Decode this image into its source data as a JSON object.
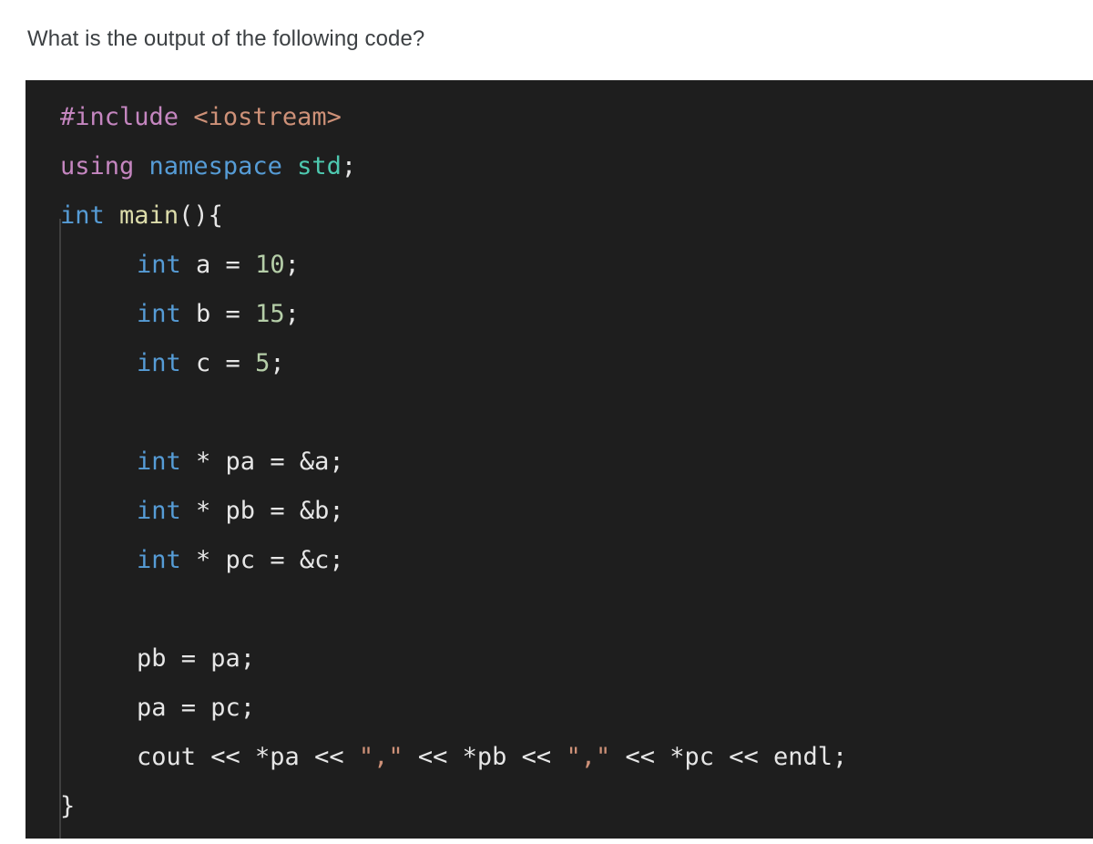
{
  "question": {
    "text": "What is the output of the following code?"
  },
  "colors": {
    "page_background": "#ffffff",
    "code_background": "#1e1e1e",
    "question_text": "#3c4043",
    "indent_guide": "#3f3f3f",
    "token_preprocessor": "#c586c0",
    "token_header": "#ce9178",
    "token_keyword": "#569cd6",
    "token_namespace": "#4ec9b0",
    "token_function": "#dcdcaa",
    "token_number": "#b5cea8",
    "token_string": "#ce9178",
    "token_plain": "#e6e6e6"
  },
  "code": {
    "language": "cpp",
    "plain_text": "#include <iostream>\nusing namespace std;\nint main(){\n    int a = 10;\n    int b = 15;\n    int c = 5;\n\n    int * pa = &a;\n    int * pb = &b;\n    int * pc = &c;\n\n    pb = pa;\n    pa = pc;\n    cout << *pa << \",\" << *pb << \",\" << *pc << endl;\n}",
    "lines": [
      {
        "indent": 0,
        "tokens": [
          {
            "t": "#include",
            "c": "tok-pre"
          },
          {
            "t": " ",
            "c": "tok-plain"
          },
          {
            "t": "<iostream>",
            "c": "tok-header"
          }
        ]
      },
      {
        "indent": 0,
        "tokens": [
          {
            "t": "using",
            "c": "tok-pre"
          },
          {
            "t": " ",
            "c": "tok-plain"
          },
          {
            "t": "namespace",
            "c": "tok-kw"
          },
          {
            "t": " ",
            "c": "tok-plain"
          },
          {
            "t": "std",
            "c": "tok-ns"
          },
          {
            "t": ";",
            "c": "tok-punct"
          }
        ]
      },
      {
        "indent": 0,
        "tokens": [
          {
            "t": "int",
            "c": "tok-kw"
          },
          {
            "t": " ",
            "c": "tok-plain"
          },
          {
            "t": "main",
            "c": "tok-fn"
          },
          {
            "t": "(){",
            "c": "tok-punct"
          }
        ]
      },
      {
        "indent": 1,
        "tokens": [
          {
            "t": "int",
            "c": "tok-kw"
          },
          {
            "t": " a = ",
            "c": "tok-plain"
          },
          {
            "t": "10",
            "c": "tok-num"
          },
          {
            "t": ";",
            "c": "tok-punct"
          }
        ]
      },
      {
        "indent": 1,
        "tokens": [
          {
            "t": "int",
            "c": "tok-kw"
          },
          {
            "t": " b = ",
            "c": "tok-plain"
          },
          {
            "t": "15",
            "c": "tok-num"
          },
          {
            "t": ";",
            "c": "tok-punct"
          }
        ]
      },
      {
        "indent": 1,
        "tokens": [
          {
            "t": "int",
            "c": "tok-kw"
          },
          {
            "t": " c = ",
            "c": "tok-plain"
          },
          {
            "t": "5",
            "c": "tok-num"
          },
          {
            "t": ";",
            "c": "tok-punct"
          }
        ]
      },
      {
        "indent": 0,
        "tokens": []
      },
      {
        "indent": 1,
        "tokens": [
          {
            "t": "int",
            "c": "tok-kw"
          },
          {
            "t": " * pa = &a;",
            "c": "tok-plain"
          }
        ]
      },
      {
        "indent": 1,
        "tokens": [
          {
            "t": "int",
            "c": "tok-kw"
          },
          {
            "t": " * pb = &b;",
            "c": "tok-plain"
          }
        ]
      },
      {
        "indent": 1,
        "tokens": [
          {
            "t": "int",
            "c": "tok-kw"
          },
          {
            "t": " * pc = &c;",
            "c": "tok-plain"
          }
        ]
      },
      {
        "indent": 0,
        "tokens": []
      },
      {
        "indent": 1,
        "tokens": [
          {
            "t": "pb = pa;",
            "c": "tok-plain"
          }
        ]
      },
      {
        "indent": 1,
        "tokens": [
          {
            "t": "pa = pc;",
            "c": "tok-plain"
          }
        ]
      },
      {
        "indent": 1,
        "tokens": [
          {
            "t": "cout << *pa << ",
            "c": "tok-plain"
          },
          {
            "t": "\",\"",
            "c": "tok-str"
          },
          {
            "t": " << *pb << ",
            "c": "tok-plain"
          },
          {
            "t": "\",\"",
            "c": "tok-str"
          },
          {
            "t": " << *pc << endl;",
            "c": "tok-plain"
          }
        ]
      },
      {
        "indent": 0,
        "tokens": [
          {
            "t": "}",
            "c": "tok-punct"
          }
        ]
      }
    ]
  }
}
